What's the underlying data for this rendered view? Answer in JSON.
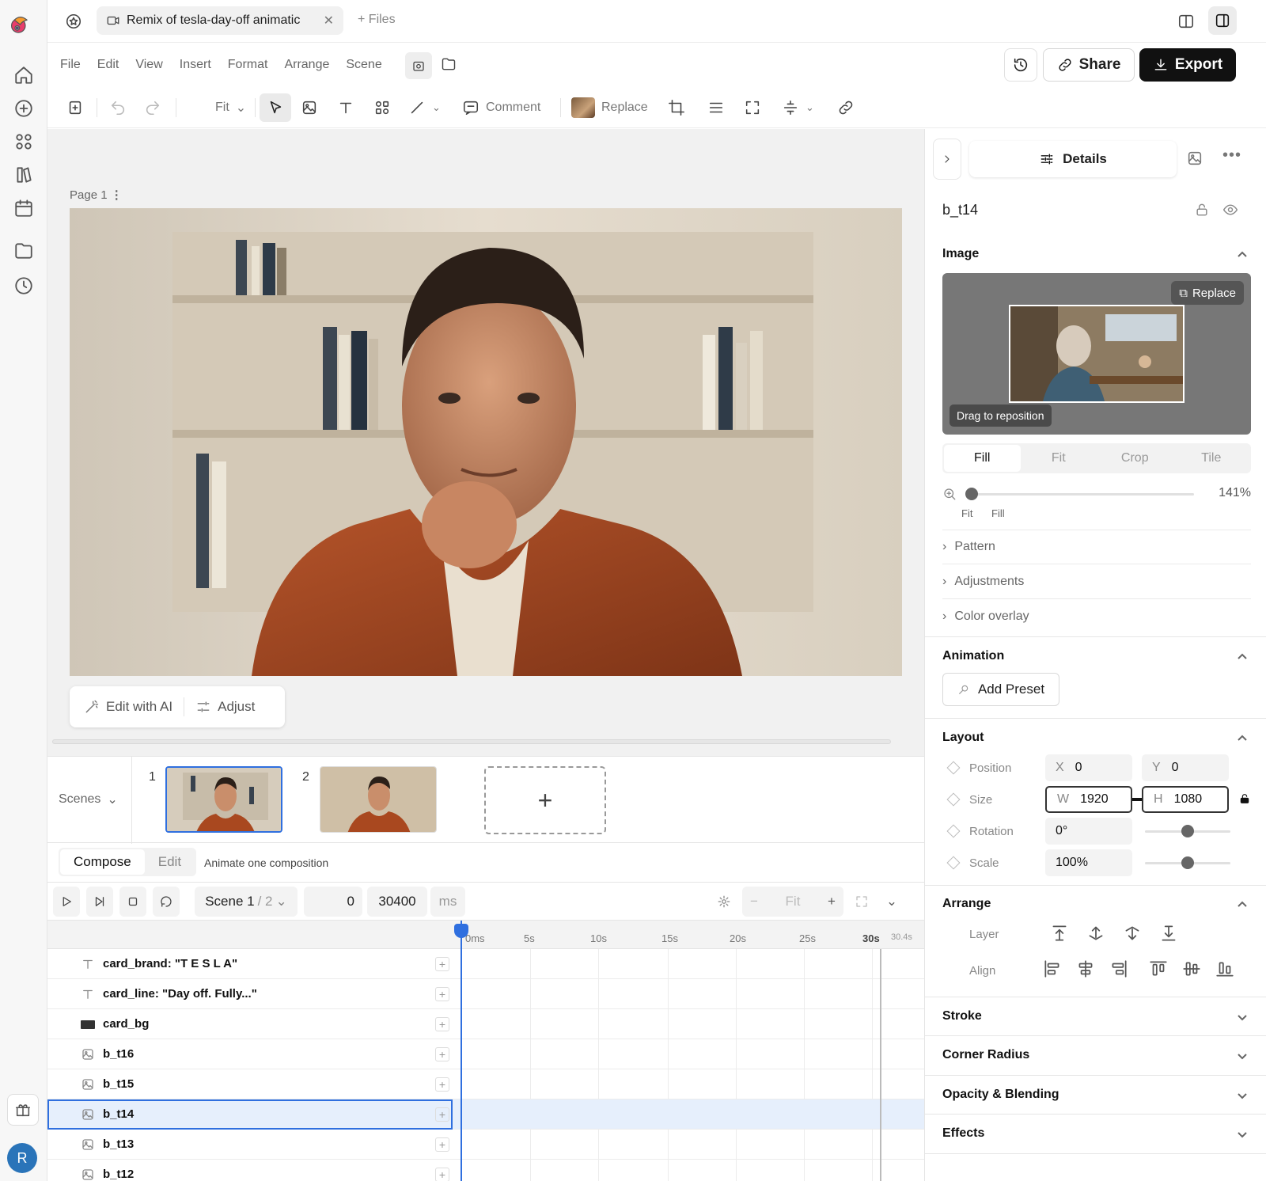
{
  "tabbar": {
    "doc_title": "Remix of tesla-day-off animatic",
    "files_label": "+ Files"
  },
  "menu": [
    "File",
    "Edit",
    "View",
    "Insert",
    "Format",
    "Arrange",
    "Scene"
  ],
  "header_actions": {
    "share": "Share",
    "export": "Export"
  },
  "toolbar": {
    "fit": "Fit",
    "comment": "Comment",
    "replace": "Replace"
  },
  "canvas": {
    "page_label": "Page 1",
    "edit_ai": "Edit with AI",
    "adjust": "Adjust"
  },
  "scenes": {
    "label": "Scenes",
    "items": [
      "1",
      "2"
    ]
  },
  "compose": {
    "tabs": [
      "Compose",
      "Edit"
    ],
    "hint": "Animate one composition"
  },
  "transport": {
    "scene": "Scene 1",
    "scene_total": "/ 2",
    "start": "0",
    "end": "30400",
    "unit": "ms",
    "fit": "Fit"
  },
  "timeline": {
    "ticks": [
      "0ms",
      "5s",
      "10s",
      "15s",
      "20s",
      "25s",
      "30s",
      "30.4s"
    ],
    "tracks": [
      {
        "name": "card_brand: \"T E S L A\"",
        "type": "text"
      },
      {
        "name": "card_line: \"Day off. Fully...\"",
        "type": "text"
      },
      {
        "name": "card_bg",
        "type": "rect"
      },
      {
        "name": "b_t16",
        "type": "image"
      },
      {
        "name": "b_t15",
        "type": "image"
      },
      {
        "name": "b_t14",
        "type": "image",
        "selected": true
      },
      {
        "name": "b_t13",
        "type": "image"
      },
      {
        "name": "b_t12",
        "type": "image"
      }
    ]
  },
  "panel": {
    "tab": "Details",
    "object_name": "b_t14",
    "image": {
      "title": "Image",
      "replace": "Replace",
      "drag": "Drag to reposition",
      "modes": [
        "Fill",
        "Fit",
        "Crop",
        "Tile"
      ],
      "zoom": "141%",
      "zoom_fit": "Fit",
      "zoom_fill": "Fill"
    },
    "collapsibles": [
      "Pattern",
      "Adjustments",
      "Color overlay"
    ],
    "animation": {
      "title": "Animation",
      "add_preset": "Add Preset"
    },
    "layout": {
      "title": "Layout",
      "position": {
        "label": "Position",
        "x_key": "X",
        "x": "0",
        "y_key": "Y",
        "y": "0"
      },
      "size": {
        "label": "Size",
        "w_key": "W",
        "w": "1920",
        "h_key": "H",
        "h": "1080"
      },
      "rotation": {
        "label": "Rotation",
        "value": "0°"
      },
      "scale": {
        "label": "Scale",
        "value": "100%"
      }
    },
    "arrange": {
      "title": "Arrange",
      "layer": "Layer",
      "align": "Align"
    },
    "sections": [
      "Stroke",
      "Corner Radius",
      "Opacity & Blending",
      "Effects"
    ]
  },
  "user": {
    "initial": "R"
  },
  "colors": {
    "accent": "#2f6fdf",
    "dark": "#111111",
    "selected_row": "#e6effc"
  }
}
